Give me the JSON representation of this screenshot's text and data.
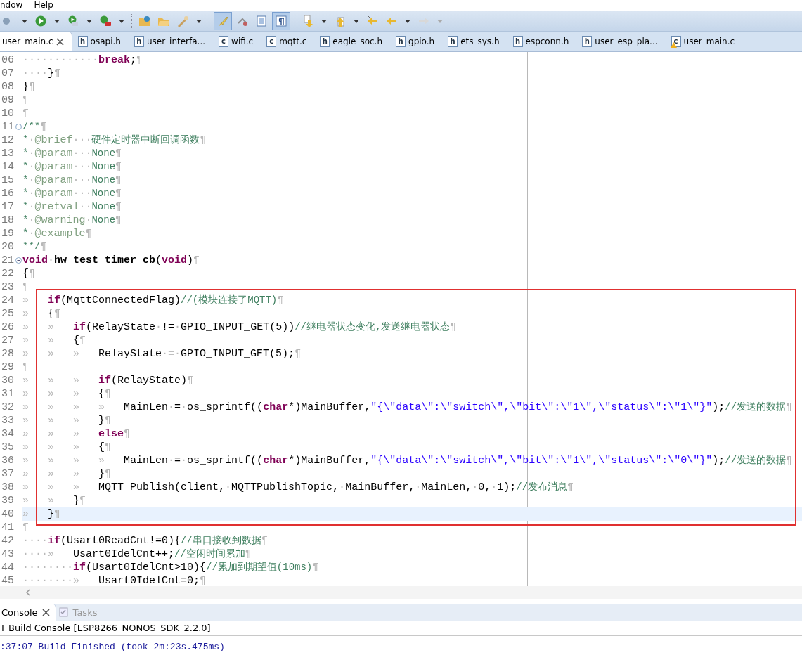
{
  "menu": [
    {
      "label": "ndow"
    },
    {
      "label": "Help"
    }
  ],
  "toolbar": {
    "toggles": [
      {
        "selected": true
      },
      {
        "selected": true
      }
    ]
  },
  "editor_tabs": [
    {
      "label": "user_main.c",
      "selected": true,
      "warning": false
    },
    {
      "label": "osapi.h",
      "icon_letter": "h",
      "selected": false,
      "warning": false
    },
    {
      "label": "user_interfa...",
      "icon_letter": "h",
      "selected": false,
      "warning": false
    },
    {
      "label": "wifi.c",
      "icon_letter": "c",
      "selected": false,
      "warning": false
    },
    {
      "label": "mqtt.c",
      "icon_letter": "c",
      "selected": false,
      "warning": false
    },
    {
      "label": "eagle_soc.h",
      "icon_letter": "h",
      "selected": false,
      "warning": false
    },
    {
      "label": "gpio.h",
      "icon_letter": "h",
      "selected": false,
      "warning": false
    },
    {
      "label": "ets_sys.h",
      "icon_letter": "h",
      "selected": false,
      "warning": false
    },
    {
      "label": "espconn.h",
      "icon_letter": "h",
      "selected": false,
      "warning": false
    },
    {
      "label": "user_esp_pla...",
      "icon_letter": "h",
      "selected": false,
      "warning": false
    },
    {
      "label": "user_main.c",
      "icon_letter": "c",
      "selected": false,
      "warning": true
    }
  ],
  "editor": {
    "lines": [
      {
        "number": "06",
        "fold": false,
        "current": false,
        "annotated": false,
        "tokens": [
          {
            "kind": "space",
            "text": "············"
          },
          {
            "kind": "keyword",
            "text": "break"
          },
          {
            "kind": "plain",
            "text": ";"
          },
          {
            "kind": "space",
            "text": "¶"
          }
        ]
      },
      {
        "number": "07",
        "fold": false,
        "current": false,
        "annotated": false,
        "tokens": [
          {
            "kind": "space",
            "text": "····"
          },
          {
            "kind": "plain",
            "text": "}"
          },
          {
            "kind": "space",
            "text": "¶"
          }
        ]
      },
      {
        "number": "08",
        "fold": false,
        "current": false,
        "annotated": false,
        "tokens": [
          {
            "kind": "plain",
            "text": "}"
          },
          {
            "kind": "space",
            "text": "¶"
          }
        ]
      },
      {
        "number": "09",
        "fold": false,
        "current": false,
        "annotated": false,
        "tokens": [
          {
            "kind": "space",
            "text": "¶"
          }
        ]
      },
      {
        "number": "10",
        "fold": false,
        "current": false,
        "annotated": false,
        "tokens": [
          {
            "kind": "space",
            "text": "¶"
          }
        ]
      },
      {
        "number": "11",
        "fold": true,
        "current": false,
        "annotated": false,
        "tokens": [
          {
            "kind": "comment",
            "text": "/**"
          },
          {
            "kind": "space",
            "text": "¶"
          }
        ]
      },
      {
        "number": "12",
        "fold": false,
        "current": false,
        "annotated": false,
        "tokens": [
          {
            "kind": "comment",
            "text": "*"
          },
          {
            "kind": "space",
            "text": "·"
          },
          {
            "kind": "tag",
            "text": "@brief"
          },
          {
            "kind": "space",
            "text": "···"
          },
          {
            "kind": "comment",
            "text": "硬件定时器中断回调函数"
          },
          {
            "kind": "space",
            "text": "¶"
          }
        ]
      },
      {
        "number": "13",
        "fold": false,
        "current": false,
        "annotated": false,
        "tokens": [
          {
            "kind": "comment",
            "text": "*"
          },
          {
            "kind": "space",
            "text": "·"
          },
          {
            "kind": "tag",
            "text": "@param"
          },
          {
            "kind": "space",
            "text": "···"
          },
          {
            "kind": "comment",
            "text": "None"
          },
          {
            "kind": "space",
            "text": "¶"
          }
        ]
      },
      {
        "number": "14",
        "fold": false,
        "current": false,
        "annotated": false,
        "tokens": [
          {
            "kind": "comment",
            "text": "*"
          },
          {
            "kind": "space",
            "text": "·"
          },
          {
            "kind": "tag",
            "text": "@param"
          },
          {
            "kind": "space",
            "text": "···"
          },
          {
            "kind": "comment",
            "text": "None"
          },
          {
            "kind": "space",
            "text": "¶"
          }
        ]
      },
      {
        "number": "15",
        "fold": false,
        "current": false,
        "annotated": false,
        "tokens": [
          {
            "kind": "comment",
            "text": "*"
          },
          {
            "kind": "space",
            "text": "·"
          },
          {
            "kind": "tag",
            "text": "@param"
          },
          {
            "kind": "space",
            "text": "···"
          },
          {
            "kind": "comment",
            "text": "None"
          },
          {
            "kind": "space",
            "text": "¶"
          }
        ]
      },
      {
        "number": "16",
        "fold": false,
        "current": false,
        "annotated": false,
        "tokens": [
          {
            "kind": "comment",
            "text": "*"
          },
          {
            "kind": "space",
            "text": "·"
          },
          {
            "kind": "tag",
            "text": "@param"
          },
          {
            "kind": "space",
            "text": "···"
          },
          {
            "kind": "comment",
            "text": "None"
          },
          {
            "kind": "space",
            "text": "¶"
          }
        ]
      },
      {
        "number": "17",
        "fold": false,
        "current": false,
        "annotated": false,
        "tokens": [
          {
            "kind": "comment",
            "text": "*"
          },
          {
            "kind": "space",
            "text": "·"
          },
          {
            "kind": "tag",
            "text": "@retval"
          },
          {
            "kind": "space",
            "text": "··"
          },
          {
            "kind": "comment",
            "text": "None"
          },
          {
            "kind": "space",
            "text": "¶"
          }
        ]
      },
      {
        "number": "18",
        "fold": false,
        "current": false,
        "annotated": false,
        "tokens": [
          {
            "kind": "comment",
            "text": "*"
          },
          {
            "kind": "space",
            "text": "·"
          },
          {
            "kind": "tag",
            "text": "@warning"
          },
          {
            "kind": "space",
            "text": "·"
          },
          {
            "kind": "comment",
            "text": "None"
          },
          {
            "kind": "space",
            "text": "¶"
          }
        ]
      },
      {
        "number": "19",
        "fold": false,
        "current": false,
        "annotated": false,
        "tokens": [
          {
            "kind": "comment",
            "text": "*"
          },
          {
            "kind": "space",
            "text": "·"
          },
          {
            "kind": "tag",
            "text": "@example"
          },
          {
            "kind": "space",
            "text": "¶"
          }
        ]
      },
      {
        "number": "20",
        "fold": false,
        "current": false,
        "annotated": false,
        "tokens": [
          {
            "kind": "comment",
            "text": "**/"
          },
          {
            "kind": "space",
            "text": "¶"
          }
        ]
      },
      {
        "number": "21",
        "fold": true,
        "current": false,
        "annotated": false,
        "tokens": [
          {
            "kind": "keyword",
            "text": "void"
          },
          {
            "kind": "space",
            "text": "·"
          },
          {
            "kind": "function",
            "text": "hw_test_timer_cb"
          },
          {
            "kind": "plain",
            "text": "("
          },
          {
            "kind": "keyword",
            "text": "void"
          },
          {
            "kind": "plain",
            "text": ")"
          },
          {
            "kind": "space",
            "text": "¶"
          }
        ]
      },
      {
        "number": "22",
        "fold": false,
        "current": false,
        "annotated": false,
        "tokens": [
          {
            "kind": "plain",
            "text": "{"
          },
          {
            "kind": "space",
            "text": "¶"
          }
        ]
      },
      {
        "number": "23",
        "fold": false,
        "current": false,
        "annotated": false,
        "tokens": [
          {
            "kind": "space",
            "text": "¶"
          }
        ]
      },
      {
        "number": "24",
        "fold": false,
        "current": false,
        "annotated": true,
        "tokens": [
          {
            "kind": "space",
            "text": "»   "
          },
          {
            "kind": "keyword",
            "text": "if"
          },
          {
            "kind": "plain",
            "text": "(MqttConnectedFlag)"
          },
          {
            "kind": "comment",
            "text": "//(模块连接了MQTT)"
          },
          {
            "kind": "space",
            "text": "¶"
          }
        ]
      },
      {
        "number": "25",
        "fold": false,
        "current": false,
        "annotated": true,
        "tokens": [
          {
            "kind": "space",
            "text": "»   "
          },
          {
            "kind": "plain",
            "text": "{"
          },
          {
            "kind": "space",
            "text": "¶"
          }
        ]
      },
      {
        "number": "26",
        "fold": false,
        "current": false,
        "annotated": true,
        "tokens": [
          {
            "kind": "space",
            "text": "»   »   "
          },
          {
            "kind": "keyword",
            "text": "if"
          },
          {
            "kind": "plain",
            "text": "(RelayState"
          },
          {
            "kind": "space",
            "text": "·"
          },
          {
            "kind": "plain",
            "text": "!="
          },
          {
            "kind": "space",
            "text": "·"
          },
          {
            "kind": "plain",
            "text": "GPIO_INPUT_GET(5))"
          },
          {
            "kind": "comment",
            "text": "//继电器状态变化,发送继电器状态"
          },
          {
            "kind": "space",
            "text": "¶"
          }
        ]
      },
      {
        "number": "27",
        "fold": false,
        "current": false,
        "annotated": true,
        "tokens": [
          {
            "kind": "space",
            "text": "»   »   "
          },
          {
            "kind": "plain",
            "text": "{"
          },
          {
            "kind": "space",
            "text": "¶"
          }
        ]
      },
      {
        "number": "28",
        "fold": false,
        "current": false,
        "annotated": true,
        "tokens": [
          {
            "kind": "space",
            "text": "»   »   »   "
          },
          {
            "kind": "plain",
            "text": "RelayState"
          },
          {
            "kind": "space",
            "text": "·"
          },
          {
            "kind": "plain",
            "text": "="
          },
          {
            "kind": "space",
            "text": "·"
          },
          {
            "kind": "plain",
            "text": "GPIO_INPUT_GET(5);"
          },
          {
            "kind": "space",
            "text": "¶"
          }
        ]
      },
      {
        "number": "29",
        "fold": false,
        "current": false,
        "annotated": true,
        "tokens": [
          {
            "kind": "space",
            "text": "¶"
          }
        ]
      },
      {
        "number": "30",
        "fold": false,
        "current": false,
        "annotated": true,
        "tokens": [
          {
            "kind": "space",
            "text": "»   »   »   "
          },
          {
            "kind": "keyword",
            "text": "if"
          },
          {
            "kind": "plain",
            "text": "(RelayState)"
          },
          {
            "kind": "space",
            "text": "¶"
          }
        ]
      },
      {
        "number": "31",
        "fold": false,
        "current": false,
        "annotated": true,
        "tokens": [
          {
            "kind": "space",
            "text": "»   »   »   "
          },
          {
            "kind": "plain",
            "text": "{"
          },
          {
            "kind": "space",
            "text": "¶"
          }
        ]
      },
      {
        "number": "32",
        "fold": false,
        "current": false,
        "annotated": true,
        "tokens": [
          {
            "kind": "space",
            "text": "»   »   »   »   "
          },
          {
            "kind": "plain",
            "text": "MainLen"
          },
          {
            "kind": "space",
            "text": "·"
          },
          {
            "kind": "plain",
            "text": "="
          },
          {
            "kind": "space",
            "text": "·"
          },
          {
            "kind": "plain",
            "text": "os_sprintf(("
          },
          {
            "kind": "keyword",
            "text": "char"
          },
          {
            "kind": "plain",
            "text": "*)MainBuffer,"
          },
          {
            "kind": "string",
            "text": "\"{\\\"data\\\":\\\"switch\\\",\\\"bit\\\":\\\"1\\\",\\\"status\\\":\\\"1\\\"}\""
          },
          {
            "kind": "plain",
            "text": ");"
          },
          {
            "kind": "comment",
            "text": "//发送的数据"
          },
          {
            "kind": "space",
            "text": "¶"
          }
        ]
      },
      {
        "number": "33",
        "fold": false,
        "current": false,
        "annotated": true,
        "tokens": [
          {
            "kind": "space",
            "text": "»   »   »   "
          },
          {
            "kind": "plain",
            "text": "}"
          },
          {
            "kind": "space",
            "text": "¶"
          }
        ]
      },
      {
        "number": "34",
        "fold": false,
        "current": false,
        "annotated": true,
        "tokens": [
          {
            "kind": "space",
            "text": "»   »   »   "
          },
          {
            "kind": "keyword",
            "text": "else"
          },
          {
            "kind": "space",
            "text": "¶"
          }
        ]
      },
      {
        "number": "35",
        "fold": false,
        "current": false,
        "annotated": true,
        "tokens": [
          {
            "kind": "space",
            "text": "»   »   »   "
          },
          {
            "kind": "plain",
            "text": "{"
          },
          {
            "kind": "space",
            "text": "¶"
          }
        ]
      },
      {
        "number": "36",
        "fold": false,
        "current": false,
        "annotated": true,
        "tokens": [
          {
            "kind": "space",
            "text": "»   »   »   »   "
          },
          {
            "kind": "plain",
            "text": "MainLen"
          },
          {
            "kind": "space",
            "text": "·"
          },
          {
            "kind": "plain",
            "text": "="
          },
          {
            "kind": "space",
            "text": "·"
          },
          {
            "kind": "plain",
            "text": "os_sprintf(("
          },
          {
            "kind": "keyword",
            "text": "char"
          },
          {
            "kind": "plain",
            "text": "*)MainBuffer,"
          },
          {
            "kind": "string",
            "text": "\"{\\\"data\\\":\\\"switch\\\",\\\"bit\\\":\\\"1\\\",\\\"status\\\":\\\"0\\\"}\""
          },
          {
            "kind": "plain",
            "text": ");"
          },
          {
            "kind": "comment",
            "text": "//发送的数据"
          },
          {
            "kind": "space",
            "text": "¶"
          }
        ]
      },
      {
        "number": "37",
        "fold": false,
        "current": false,
        "annotated": true,
        "tokens": [
          {
            "kind": "space",
            "text": "»   »   »   "
          },
          {
            "kind": "plain",
            "text": "}"
          },
          {
            "kind": "space",
            "text": "¶"
          }
        ]
      },
      {
        "number": "38",
        "fold": false,
        "current": false,
        "annotated": true,
        "tokens": [
          {
            "kind": "space",
            "text": "»   »   »   "
          },
          {
            "kind": "plain",
            "text": "MQTT_Publish(client,"
          },
          {
            "kind": "space",
            "text": "·"
          },
          {
            "kind": "plain",
            "text": "MQTTPublishTopic,"
          },
          {
            "kind": "space",
            "text": "·"
          },
          {
            "kind": "plain",
            "text": "MainBuffer,"
          },
          {
            "kind": "space",
            "text": "·"
          },
          {
            "kind": "plain",
            "text": "MainLen,"
          },
          {
            "kind": "space",
            "text": "·"
          },
          {
            "kind": "plain",
            "text": "0,"
          },
          {
            "kind": "space",
            "text": "·"
          },
          {
            "kind": "plain",
            "text": "1);"
          },
          {
            "kind": "comment",
            "text": "//发布消息"
          },
          {
            "kind": "space",
            "text": "¶"
          }
        ]
      },
      {
        "number": "39",
        "fold": false,
        "current": false,
        "annotated": true,
        "tokens": [
          {
            "kind": "space",
            "text": "»   »   "
          },
          {
            "kind": "plain",
            "text": "}"
          },
          {
            "kind": "space",
            "text": "¶"
          }
        ]
      },
      {
        "number": "40",
        "fold": false,
        "current": true,
        "annotated": true,
        "tokens": [
          {
            "kind": "space",
            "text": "»   "
          },
          {
            "kind": "plain",
            "text": "}"
          },
          {
            "kind": "space",
            "text": "¶"
          }
        ]
      },
      {
        "number": "41",
        "fold": false,
        "current": false,
        "annotated": false,
        "tokens": [
          {
            "kind": "space",
            "text": "¶"
          }
        ]
      },
      {
        "number": "42",
        "fold": false,
        "current": false,
        "annotated": false,
        "tokens": [
          {
            "kind": "space",
            "text": "····"
          },
          {
            "kind": "keyword",
            "text": "if"
          },
          {
            "kind": "plain",
            "text": "(Usart0ReadCnt!=0){"
          },
          {
            "kind": "comment",
            "text": "//串口接收到数据"
          },
          {
            "kind": "space",
            "text": "¶"
          }
        ]
      },
      {
        "number": "43",
        "fold": false,
        "current": false,
        "annotated": false,
        "tokens": [
          {
            "kind": "space",
            "text": "····»   "
          },
          {
            "kind": "plain",
            "text": "Usart0IdelCnt++;"
          },
          {
            "kind": "comment",
            "text": "//空闲时间累加"
          },
          {
            "kind": "space",
            "text": "¶"
          }
        ]
      },
      {
        "number": "44",
        "fold": false,
        "current": false,
        "annotated": false,
        "tokens": [
          {
            "kind": "space",
            "text": "········"
          },
          {
            "kind": "keyword",
            "text": "if"
          },
          {
            "kind": "plain",
            "text": "(Usart0IdelCnt>10){"
          },
          {
            "kind": "comment",
            "text": "//累加到期望值(10ms)"
          },
          {
            "kind": "space",
            "text": "¶"
          }
        ]
      },
      {
        "number": "45",
        "fold": false,
        "current": false,
        "annotated": false,
        "tokens": [
          {
            "kind": "space",
            "text": "········»   "
          },
          {
            "kind": "plain",
            "text": "Usart0IdelCnt=0;"
          },
          {
            "kind": "space",
            "text": "¶"
          }
        ]
      }
    ]
  },
  "console": {
    "tabs": [
      {
        "label": "Console",
        "selected": true
      },
      {
        "label": "Tasks",
        "selected": false
      }
    ],
    "title": "T Build Console [ESP8266_NONOS_SDK_2.2.0]",
    "output": ":37:07 Build Finished (took 2m:23s.475ms)"
  }
}
